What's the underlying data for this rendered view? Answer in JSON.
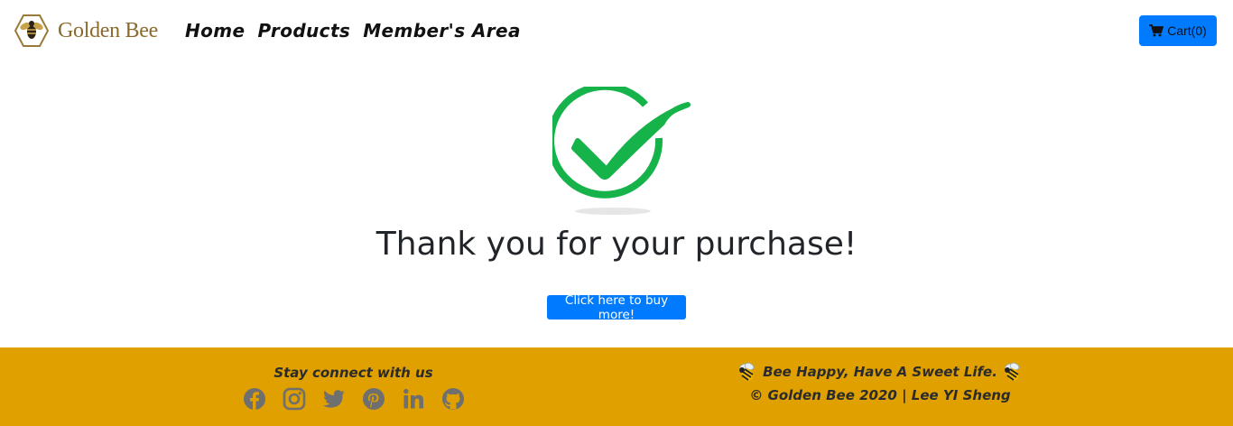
{
  "nav": {
    "brand": "Golden Bee",
    "links": [
      "Home",
      "Products",
      "Member's Area"
    ],
    "cart_label": "Cart(0)"
  },
  "main": {
    "thank_you": "Thank you for your purchase!",
    "buy_more_label": "Click here to buy more!"
  },
  "footer": {
    "stay_connected": "Stay connect with us",
    "socials": [
      "facebook-icon",
      "instagram-icon",
      "twitter-icon",
      "pinterest-icon",
      "linkedin-icon",
      "github-icon"
    ],
    "tagline": "Bee Happy, Have A Sweet Life.",
    "copyright": "© Golden Bee 2020 | Lee YI Sheng"
  },
  "colors": {
    "accent": "#007bff",
    "footer_bg": "#dfa000",
    "check_green": "#16b34a",
    "brand_gold": "#8a6a2c",
    "social_grey": "#6f6f6f"
  }
}
